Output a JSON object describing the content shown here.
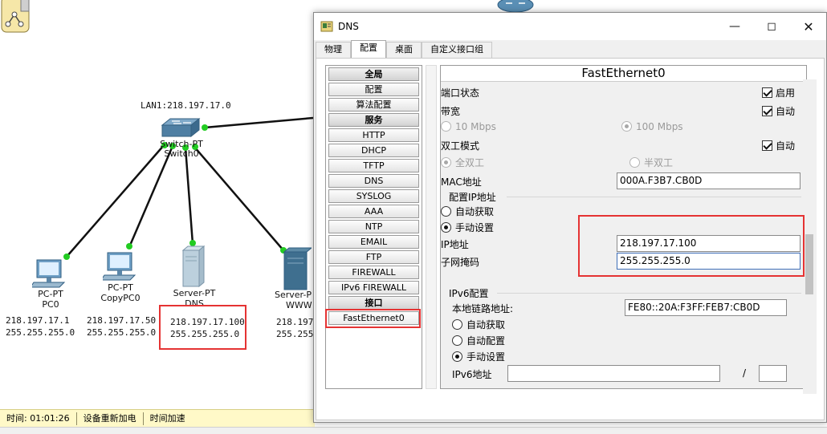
{
  "topology": {
    "lan_label": "LAN1:218.197.17.0",
    "switch": {
      "type": "Switch-PT",
      "name": "Switch0"
    },
    "devices": [
      {
        "type": "PC-PT",
        "name": "PC0",
        "ip": "218.197.17.1",
        "mask": "255.255.255.0"
      },
      {
        "type": "PC-PT",
        "name": "CopyPC0",
        "ip": "218.197.17.50",
        "mask": "255.255.255.0"
      },
      {
        "type": "Server-PT",
        "name": "DNS",
        "ip": "218.197.17.100",
        "mask": "255.255.255.0"
      },
      {
        "type": "Server-P",
        "name": "WWW",
        "ip": "218.197.",
        "mask": "255.255."
      }
    ]
  },
  "statusbar": {
    "time": "时间: 01:01:26",
    "power_cycle": "设备重新加电",
    "fast_forward": "时间加速"
  },
  "window": {
    "title": "DNS",
    "tabs": [
      "物理",
      "配置",
      "桌面",
      "自定义接口组"
    ],
    "active_tab": "配置"
  },
  "nav": {
    "items": [
      {
        "label": "全局",
        "kind": "header"
      },
      {
        "label": "配置",
        "kind": "item"
      },
      {
        "label": "算法配置",
        "kind": "item"
      },
      {
        "label": "服务",
        "kind": "header"
      },
      {
        "label": "HTTP",
        "kind": "item"
      },
      {
        "label": "DHCP",
        "kind": "item"
      },
      {
        "label": "TFTP",
        "kind": "item"
      },
      {
        "label": "DNS",
        "kind": "item"
      },
      {
        "label": "SYSLOG",
        "kind": "item"
      },
      {
        "label": "AAA",
        "kind": "item"
      },
      {
        "label": "NTP",
        "kind": "item"
      },
      {
        "label": "EMAIL",
        "kind": "item"
      },
      {
        "label": "FTP",
        "kind": "item"
      },
      {
        "label": "FIREWALL",
        "kind": "item"
      },
      {
        "label": "IPv6 FIREWALL",
        "kind": "item"
      },
      {
        "label": "接口",
        "kind": "header"
      },
      {
        "label": "FastEthernet0",
        "kind": "selected"
      }
    ]
  },
  "panel": {
    "title": "FastEthernet0",
    "port_status_label": "端口状态",
    "port_on_label": "启用",
    "bandwidth_label": "带宽",
    "auto_label": "自动",
    "bw_10": "10 Mbps",
    "bw_100": "100 Mbps",
    "duplex_label": "双工模式",
    "full_duplex": "全双工",
    "half_duplex": "半双工",
    "mac_label": "MAC地址",
    "mac_value": "000A.F3B7.CB0D",
    "ip_config_label": "配置IP地址",
    "dhcp_label": "自动获取",
    "static_label": "手动设置",
    "ip_label": "IP地址",
    "ip_value": "218.197.17.100",
    "mask_label": "子网掩码",
    "mask_value": "255.255.255.0",
    "ipv6_config_label": "IPv6配置",
    "link_local_label": "本地链路地址:",
    "link_local_value": "FE80::20A:F3FF:FEB7:CB0D",
    "ipv6_auto_label": "自动获取",
    "ipv6_autoconf_label": "自动配置",
    "ipv6_static_label": "手动设置",
    "ipv6_addr_label": "IPv6地址",
    "ipv6_addr_value": "",
    "ipv6_prefix_value": "",
    "slash": "/"
  },
  "colors": {
    "highlight": "#e53333",
    "link": "#111111",
    "port": "#22cc22"
  }
}
